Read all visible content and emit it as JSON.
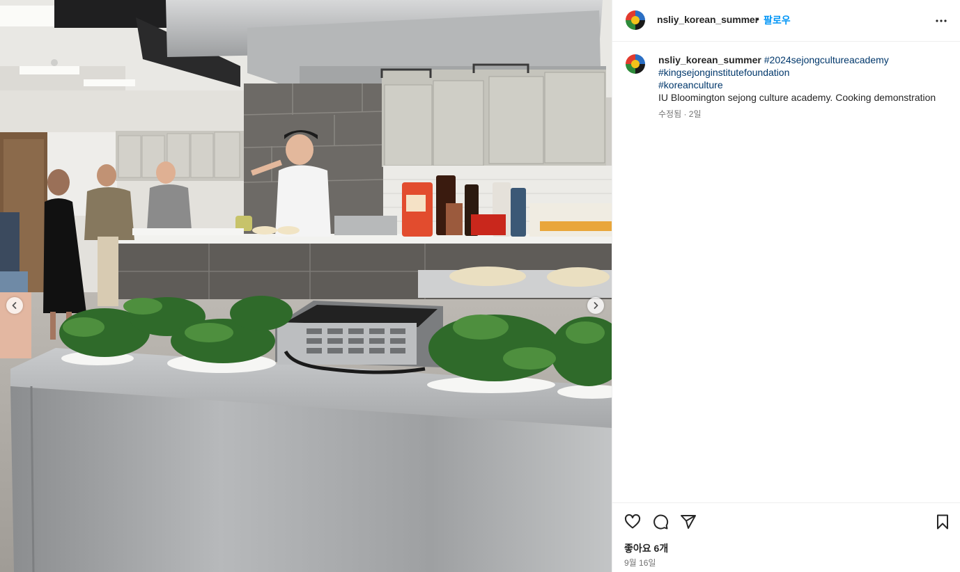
{
  "post": {
    "username": "nsliy_korean_summer",
    "separator": "•",
    "follow_label": "팔로우",
    "more_icon": "more-horizontal-icon",
    "caption": {
      "username": "nsliy_korean_summer",
      "hashtags": [
        "#2024sejongcultureacademy",
        "#kingsejonginstitutefoundation",
        "#koreanculture"
      ],
      "text": "IU Bloomington sejong culture academy. Cooking demonstration",
      "meta": "수정됨 · 2일"
    },
    "actions": {
      "like_icon": "heart-icon",
      "comment_icon": "comment-bubble-icon",
      "share_icon": "paper-plane-icon",
      "save_icon": "bookmark-icon"
    },
    "likes_label": "좋아요 6개",
    "date_label": "9월 16일"
  },
  "media": {
    "image_subject": "cooking demonstration photo",
    "prev_icon": "chevron-left-icon",
    "next_icon": "chevron-right-icon"
  },
  "colors": {
    "link": "#00376b",
    "follow": "#0095f6",
    "muted": "#737373",
    "text": "#262626"
  }
}
